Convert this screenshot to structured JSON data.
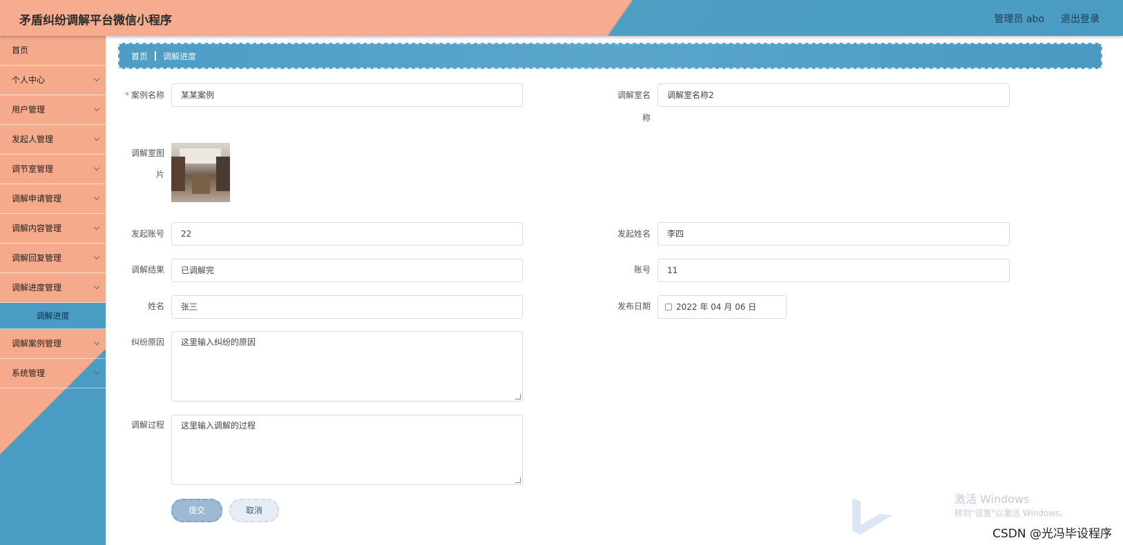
{
  "header": {
    "title": "矛盾纠纷调解平台微信小程序",
    "user": "管理员 abo",
    "logout": "退出登录"
  },
  "sidebar": {
    "items": [
      {
        "label": "首页"
      },
      {
        "label": "个人中心"
      },
      {
        "label": "用户管理"
      },
      {
        "label": "发起人管理"
      },
      {
        "label": "调节室管理"
      },
      {
        "label": "调解申请管理"
      },
      {
        "label": "调解内容管理"
      },
      {
        "label": "调解回复管理"
      },
      {
        "label": "调解进度管理"
      },
      {
        "label": "调解进度"
      },
      {
        "label": "调解案例管理"
      },
      {
        "label": "系统管理"
      }
    ]
  },
  "breadcrumb": {
    "home": "首页",
    "current": "调解进度"
  },
  "form": {
    "case_name": {
      "label": "案例名称",
      "value": "某某案例"
    },
    "room_name": {
      "label_line1": "调解室名",
      "label_line2": "称",
      "value": "调解室名称2"
    },
    "room_image": {
      "label_line1": "调解室图",
      "label_line2": "片"
    },
    "initiator_account": {
      "label": "发起账号",
      "value": "22"
    },
    "initiator_name": {
      "label": "发起姓名",
      "value": "李四"
    },
    "result": {
      "label": "调解结果",
      "value": "已调解完"
    },
    "account": {
      "label": "账号",
      "value": "11"
    },
    "name": {
      "label": "姓名",
      "value": "张三"
    },
    "publish_date": {
      "label": "发布日期",
      "value": "2022 年 04 月 06 日"
    },
    "dispute_reason": {
      "label": "纠纷原因",
      "value": "这里输入纠纷的原因"
    },
    "mediation_process": {
      "label": "调解过程",
      "value": "这里输入调解的过程"
    }
  },
  "buttons": {
    "submit": "提交",
    "cancel": "取消"
  },
  "watermark": {
    "line1": "激活 Windows",
    "line2": "转到\"设置\"以激活 Windows。",
    "csdn": "CSDN @光冯毕设程序"
  }
}
